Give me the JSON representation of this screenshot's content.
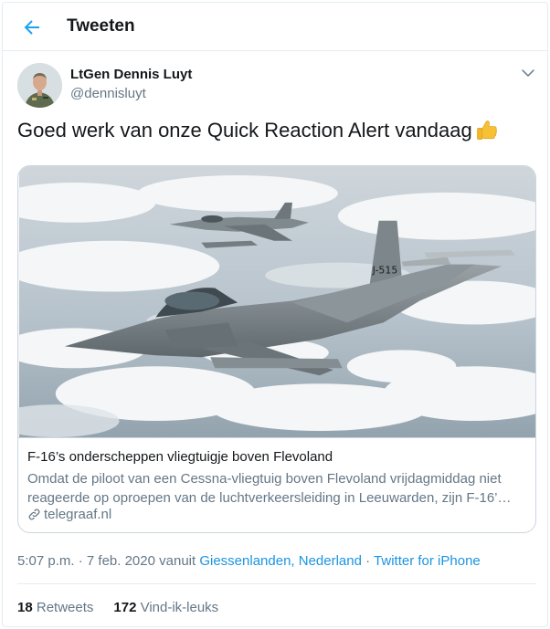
{
  "header": {
    "title": "Tweeten",
    "back_icon": "arrow-left-icon"
  },
  "author": {
    "name": "LtGen Dennis Luyt",
    "handle": "@dennisluyt"
  },
  "tweet": {
    "text": "Goed werk van onze Quick Reaction Alert vandaag",
    "emoji": "thumbs-up-icon"
  },
  "card": {
    "title": "F-16’s onderscheppen vliegtuigje boven Flevoland",
    "description": "Omdat de piloot van een Cessna-vliegtuig boven Flevoland vrijdagmiddag niet reageerde op oproepen van de luchtverkeersleiding in Leeuwarden, zijn F-16’…",
    "domain": "telegraaf.nl",
    "image_tail_number": "J-515"
  },
  "meta": {
    "time": "5:07 p.m.",
    "separator1": " · ",
    "date": "7 feb. 2020",
    "via": " vanuit ",
    "location": "Giessenlanden, Nederland",
    "separator2": " · ",
    "source": "Twitter for iPhone"
  },
  "stats": {
    "retweets_count": "18",
    "retweets_label": "Retweets",
    "likes_count": "172",
    "likes_label": "Vind-ik-leuks"
  },
  "colors": {
    "accent": "#1b95e0",
    "secondary_text": "#657786",
    "border": "#e6ecf0"
  }
}
